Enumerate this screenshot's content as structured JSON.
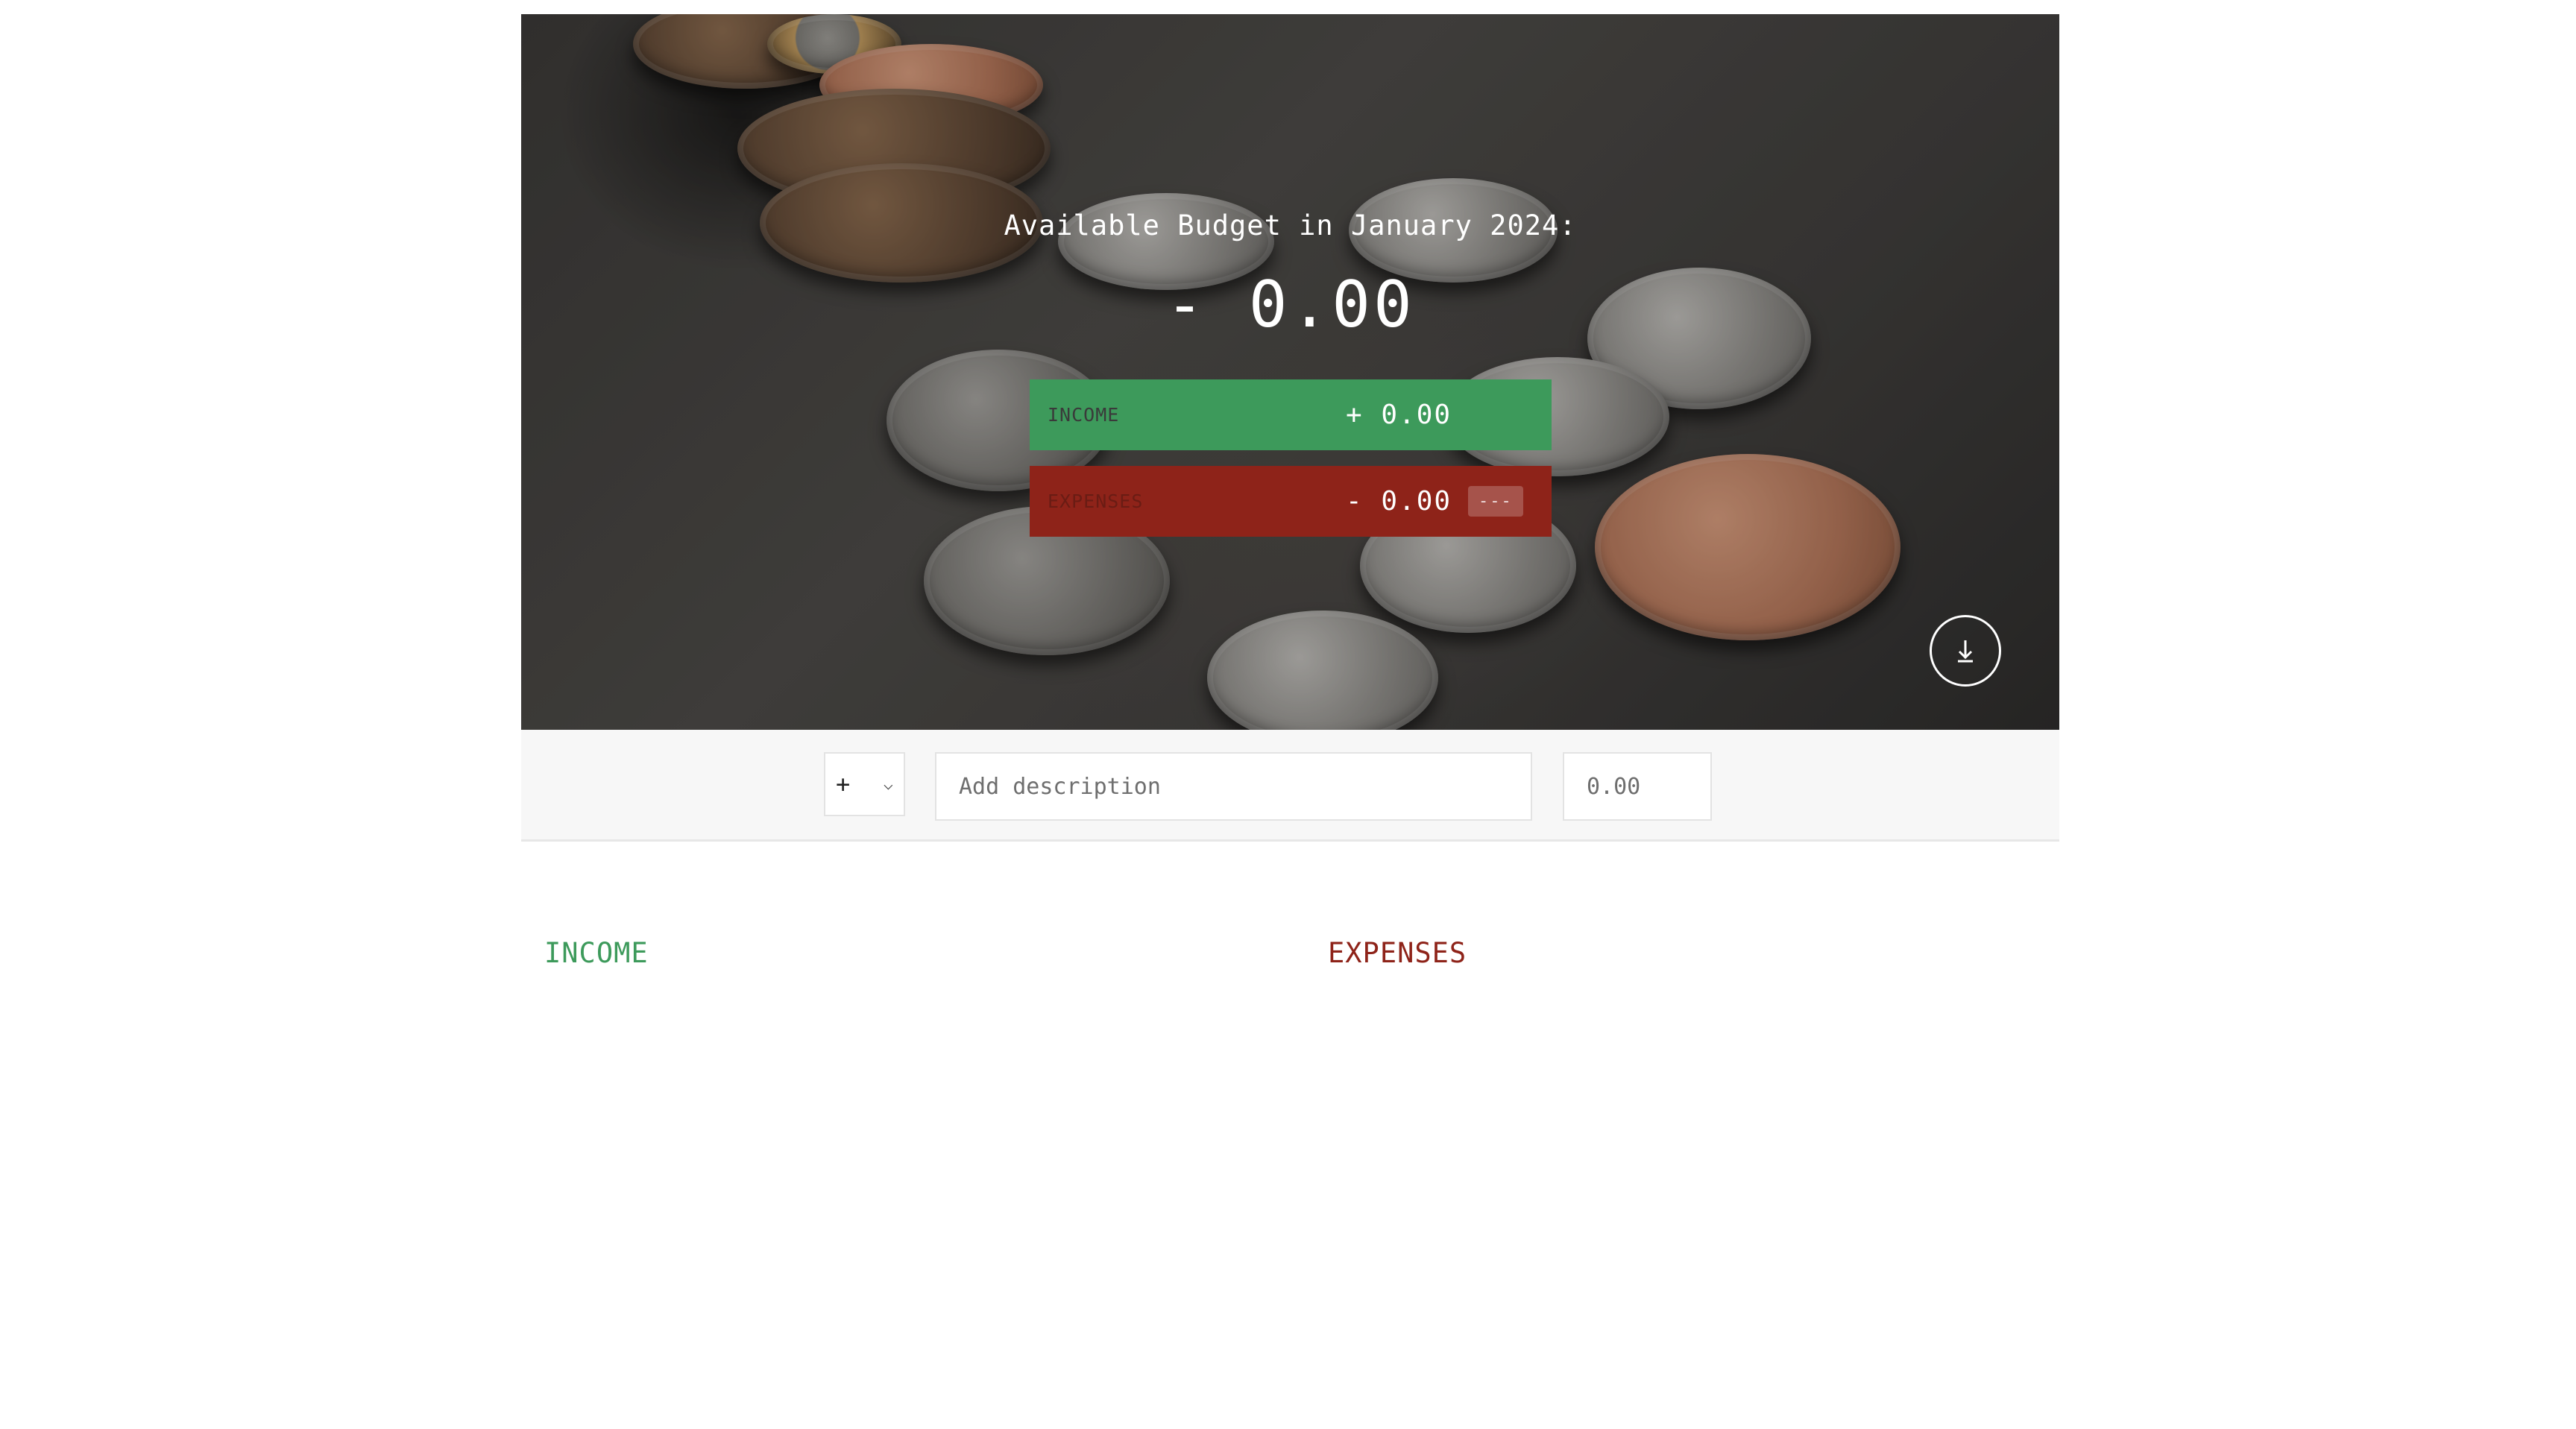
{
  "header": {
    "budget_title": "Available Budget in January 2024:",
    "budget_value": "- 0.00",
    "income": {
      "label": "INCOME",
      "value": "+ 0.00"
    },
    "expenses": {
      "label": "EXPENSES",
      "value": "- 0.00",
      "percentage": "---"
    },
    "scroll_icon": "arrow-down-to-line-icon"
  },
  "add_form": {
    "type_selected": "+",
    "description_placeholder": "Add description",
    "value_placeholder": "0.00"
  },
  "lists": {
    "income_title": "INCOME",
    "expenses_title": "EXPENSES"
  },
  "colors": {
    "income": "#3d9a5b",
    "expenses": "#8e2319"
  }
}
